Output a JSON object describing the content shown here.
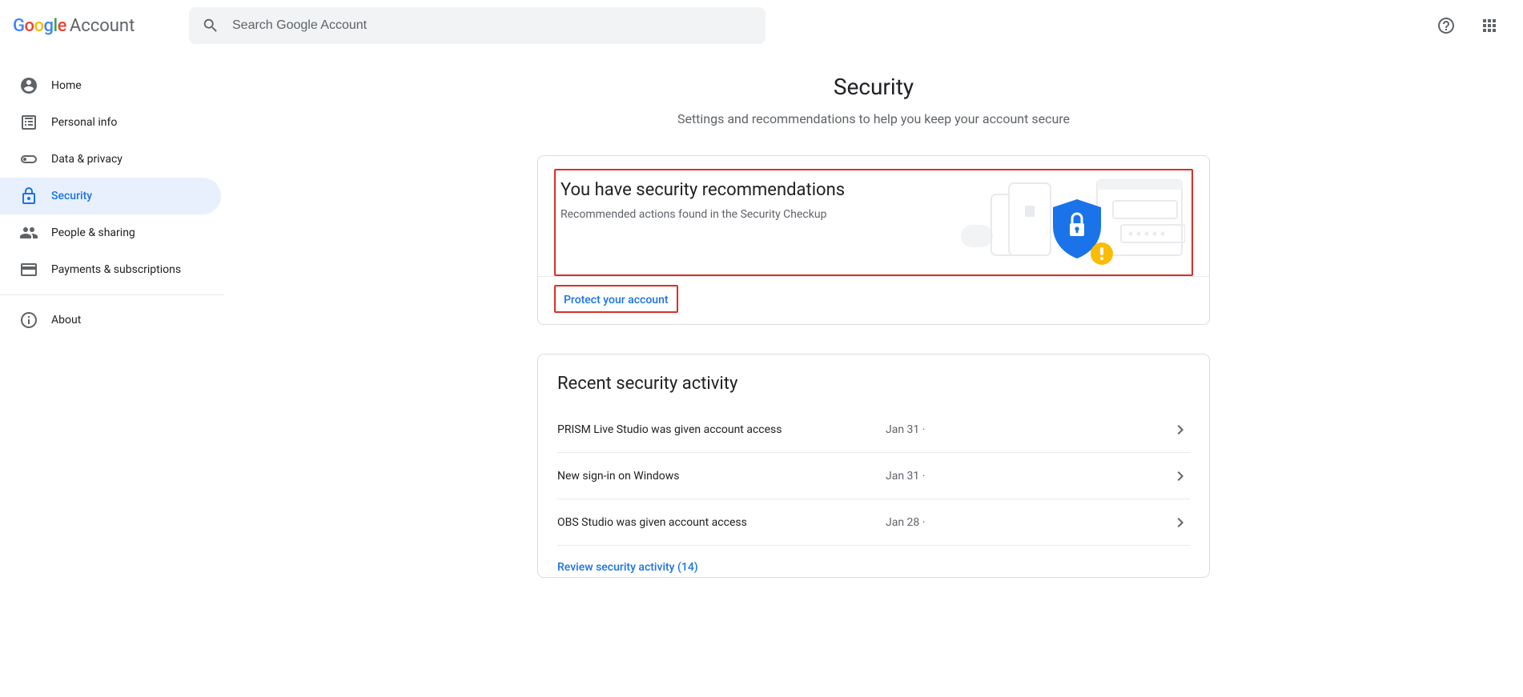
{
  "header": {
    "logo_product": "Account",
    "search_placeholder": "Search Google Account"
  },
  "sidebar": {
    "items": [
      {
        "label": "Home"
      },
      {
        "label": "Personal info"
      },
      {
        "label": "Data & privacy"
      },
      {
        "label": "Security"
      },
      {
        "label": "People & sharing"
      },
      {
        "label": "Payments & subscriptions"
      },
      {
        "label": "About"
      }
    ]
  },
  "page": {
    "title": "Security",
    "subtitle": "Settings and recommendations to help you keep your account secure"
  },
  "recommendations": {
    "title": "You have security recommendations",
    "subtitle": "Recommended actions found in the Security Checkup",
    "cta": "Protect your account"
  },
  "activity": {
    "title": "Recent security activity",
    "review_label": "Review security activity (14)",
    "rows": [
      {
        "desc": "PRISM Live Studio was given account access",
        "date": "Jan 31"
      },
      {
        "desc": "New sign-in on Windows",
        "date": "Jan 31"
      },
      {
        "desc": "OBS Studio was given account access",
        "date": "Jan 28"
      }
    ]
  }
}
